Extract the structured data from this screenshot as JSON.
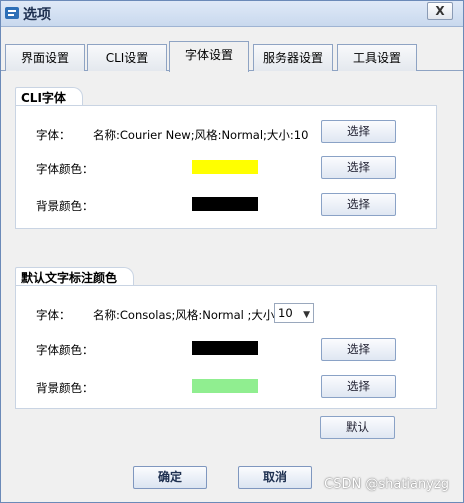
{
  "window": {
    "title": "选项",
    "close_label": "X"
  },
  "tabs": [
    {
      "label": "界面设置"
    },
    {
      "label": "CLI设置"
    },
    {
      "label": "字体设置"
    },
    {
      "label": "服务器设置"
    },
    {
      "label": "工具设置"
    }
  ],
  "active_tab": "字体设置",
  "cli_font": {
    "group_title": "CLI字体",
    "font_label": "字体：",
    "font_value": "名称:Courier New;风格:Normal;大小:10",
    "font_color_label": "字体颜色：",
    "font_color": "#ffff00",
    "bg_color_label": "背景颜色：",
    "bg_color": "#000000",
    "choose_label": "选择"
  },
  "annotation_font": {
    "group_title": "默认文字标注颜色",
    "font_label": "字体：",
    "font_value": "名称:Consolas;风格:Normal ;大小:",
    "size_value": "10",
    "font_color_label": "字体颜色：",
    "font_color": "#000000",
    "bg_color_label": "背景颜色：",
    "bg_color": "#90ee90",
    "choose_label": "选择",
    "default_label": "默认"
  },
  "footer": {
    "ok_label": "确定",
    "cancel_label": "取消"
  },
  "watermark": "CSDN @shatianyzg"
}
